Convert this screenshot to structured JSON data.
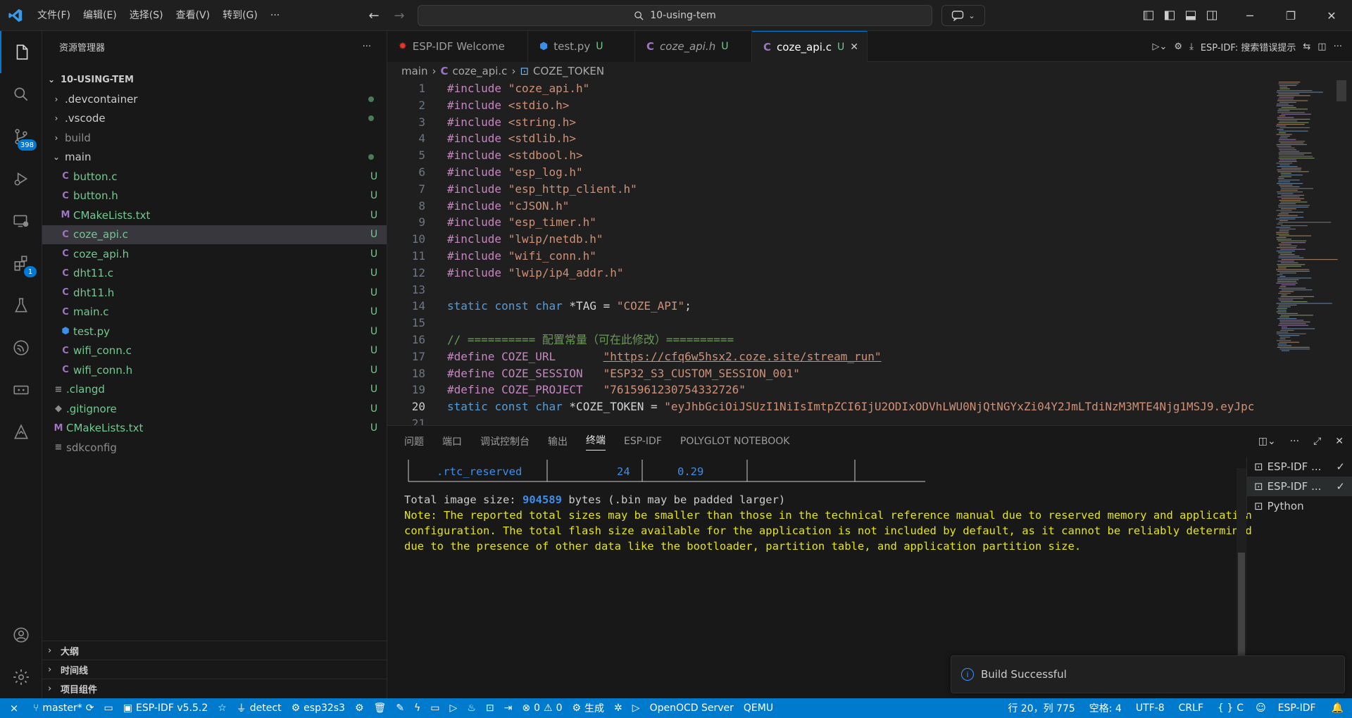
{
  "menu": [
    "文件(F)",
    "编辑(E)",
    "选择(S)",
    "查看(V)",
    "转到(G)",
    "···"
  ],
  "search": {
    "text": "10-using-tem"
  },
  "sidebar": {
    "title": "资源管理器",
    "more": "···",
    "root": "10-USING-TEM",
    "tree": [
      {
        "name": ".devcontainer",
        "type": "folder",
        "status": "dot"
      },
      {
        "name": ".vscode",
        "type": "folder",
        "status": "dot"
      },
      {
        "name": "build",
        "type": "folder",
        "status": ""
      },
      {
        "name": "main",
        "type": "folder-open",
        "status": "dot"
      },
      {
        "name": "button.c",
        "type": "c",
        "status": "U"
      },
      {
        "name": "button.h",
        "type": "c",
        "status": "U"
      },
      {
        "name": "CMakeLists.txt",
        "type": "m",
        "status": "U"
      },
      {
        "name": "coze_api.c",
        "type": "c",
        "status": "U",
        "selected": true
      },
      {
        "name": "coze_api.h",
        "type": "c",
        "status": "U"
      },
      {
        "name": "dht11.c",
        "type": "c",
        "status": "U"
      },
      {
        "name": "dht11.h",
        "type": "c",
        "status": "U"
      },
      {
        "name": "main.c",
        "type": "c",
        "status": "U"
      },
      {
        "name": "test.py",
        "type": "py",
        "status": "U"
      },
      {
        "name": "wifi_conn.c",
        "type": "c",
        "status": "U"
      },
      {
        "name": "wifi_conn.h",
        "type": "c",
        "status": "U"
      },
      {
        "name": ".clangd",
        "type": "eq",
        "status": "U"
      },
      {
        "name": ".gitignore",
        "type": "git",
        "status": "U"
      },
      {
        "name": "CMakeLists.txt",
        "type": "m",
        "status": "U"
      },
      {
        "name": "sdkconfig",
        "type": "eq",
        "status": ""
      }
    ],
    "sections": [
      "大纲",
      "时间线",
      "项目组件"
    ]
  },
  "activity": {
    "scm_badge": "398",
    "ext_badge": "1"
  },
  "tabs": [
    {
      "label": "ESP-IDF Welcome",
      "status": ""
    },
    {
      "label": "test.py",
      "status": "U"
    },
    {
      "label": "coze_api.h",
      "status": "U"
    },
    {
      "label": "coze_api.c",
      "status": "U",
      "close": "✕"
    }
  ],
  "tab_actions": {
    "esp_label": "ESP-IDF:",
    "esp_hint": "搜索错误提示"
  },
  "breadcrumb": {
    "folder": "main",
    "file": "coze_api.c",
    "symbol": "COZE_TOKEN"
  },
  "code": {
    "numbers": [
      "1",
      "2",
      "3",
      "4",
      "5",
      "6",
      "7",
      "8",
      "9",
      "10",
      "11",
      "12",
      "13",
      "14",
      "15",
      "16",
      "17",
      "18",
      "19",
      "20",
      "21"
    ],
    "l1": "\"coze_api.h\"",
    "l2": "<stdio.h>",
    "l3": "<string.h>",
    "l4": "<stdlib.h>",
    "l5": "<stdbool.h>",
    "l6": "\"esp_log.h\"",
    "l7": "\"esp_http_client.h\"",
    "l8": "\"cJSON.h\"",
    "l9": "\"esp_timer.h\"",
    "l10": "\"lwip/netdb.h\"",
    "l11": "\"wifi_conn.h\"",
    "l12": "\"lwip/ip4_addr.h\"",
    "include_kw": "#include",
    "define_kw": "#define",
    "l14_tag": "\"COZE_API\"",
    "l16_comment": "// ========== 配置常量（可在此修改）==========",
    "l17_name": "COZE_URL",
    "l17_val": "\"https://cfq6w5hsx2.coze.site/stream_run\"",
    "l18_name": "COZE_SESSION",
    "l18_val": "\"ESP32_S3_CUSTOM_SESSION_001\"",
    "l19_name": "COZE_PROJECT",
    "l19_val": "\"7615961230754332726\"",
    "l20_var": "*COZE_TOKEN = ",
    "l20_val": "\"eyJhbGciOiJSUzI1NiIsImtpZCI6IjU2ODIxODVhLWU0NjQtNGYxZi04Y2JmLTdiNzM3MTE4Njg1MSJ9.eyJpc"
  },
  "panel": {
    "tabs": [
      "问题",
      "端口",
      "调试控制台",
      "输出",
      "终端",
      "ESP-IDF",
      "POLYGLOT NOTEBOOK"
    ],
    "active_tab": "终端",
    "table_row": {
      "name": ".rtc_reserved",
      "size": "24",
      "pct": "0.29"
    },
    "total_prefix": "Total image size: ",
    "total_num": "904589",
    "total_suffix": " bytes (.bin may be padded larger)",
    "note_1": "Note: The reported total sizes may be smaller than those in the technical reference manual due to reserved memory and application",
    "note_2": "configuration. The total flash size available for the application is not included by default, as it cannot be reliably determined",
    "note_3": "due to the presence of other data like the bootloader, partition table, and application partition size.",
    "terminals": [
      {
        "label": "ESP-IDF ...",
        "check": "✓"
      },
      {
        "label": "ESP-IDF ...",
        "check": "✓",
        "selected": true
      },
      {
        "label": "Python",
        "check": ""
      }
    ]
  },
  "toast": {
    "message": "Build Successful"
  },
  "statusbar": {
    "branch": "master*",
    "idf_version": "ESP-IDF v5.5.2",
    "detect": "detect",
    "target": "esp32s3",
    "errors": "0",
    "warnings": "0",
    "build": "生成",
    "openocd": "OpenOCD Server",
    "qemu": "QEMU",
    "position": "行 20，列 775",
    "spaces": "空格: 4",
    "encoding": "UTF-8",
    "eol": "CRLF",
    "lang": "C",
    "esp": "ESP-IDF"
  },
  "colors": {
    "accent": "#007acc",
    "tab_accent": "#0078d4",
    "git_untracked": "#73c991"
  }
}
